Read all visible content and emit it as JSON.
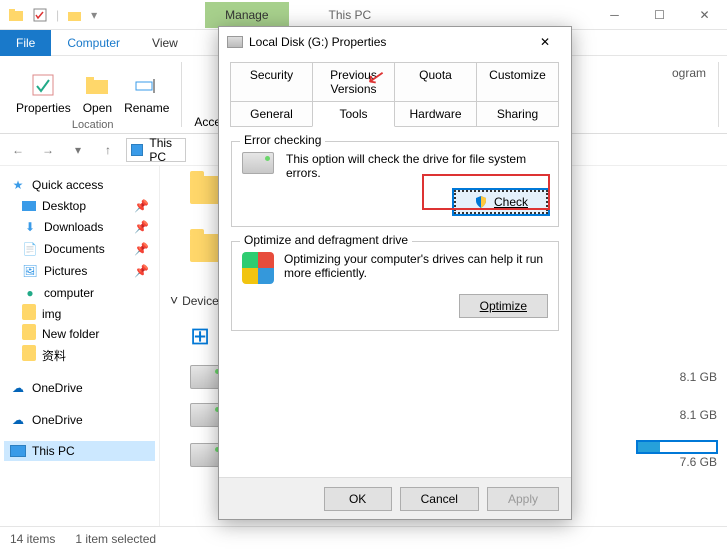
{
  "titlebar": {
    "manage": "Manage",
    "thispc": "This PC"
  },
  "ribbon_tabs": {
    "file": "File",
    "computer": "Computer",
    "view": "View"
  },
  "ribbon": {
    "properties": "Properties",
    "open": "Open",
    "rename": "Rename",
    "access_media": "Access media",
    "location_group": "Location",
    "right_label": "ogram"
  },
  "address": {
    "location": "This PC"
  },
  "sidebar": {
    "quick_access": "Quick access",
    "desktop": "Desktop",
    "downloads": "Downloads",
    "documents": "Documents",
    "pictures": "Pictures",
    "computer": "computer",
    "img": "img",
    "new_folder": "New folder",
    "ziliao": "资料",
    "onedrive": "OneDrive",
    "thispc": "This PC"
  },
  "content": {
    "devices_header": "Devices",
    "drive_free": "8.1 GB",
    "drive_free2": "8.1 GB",
    "drive_free3": "7.6 GB"
  },
  "status": {
    "count": "14 items",
    "selected": "1 item selected"
  },
  "dialog": {
    "title": "Local Disk (G:) Properties",
    "tabs": {
      "security": "Security",
      "previous": "Previous Versions",
      "quota": "Quota",
      "customize": "Customize",
      "general": "General",
      "tools": "Tools",
      "hardware": "Hardware",
      "sharing": "Sharing"
    },
    "error_check": {
      "legend": "Error checking",
      "text": "This option will check the drive for file system errors.",
      "button": "Check"
    },
    "optimize": {
      "legend": "Optimize and defragment drive",
      "text": "Optimizing your computer's drives can help it run more efficiently.",
      "button": "Optimize"
    },
    "footer": {
      "ok": "OK",
      "cancel": "Cancel",
      "apply": "Apply"
    }
  }
}
